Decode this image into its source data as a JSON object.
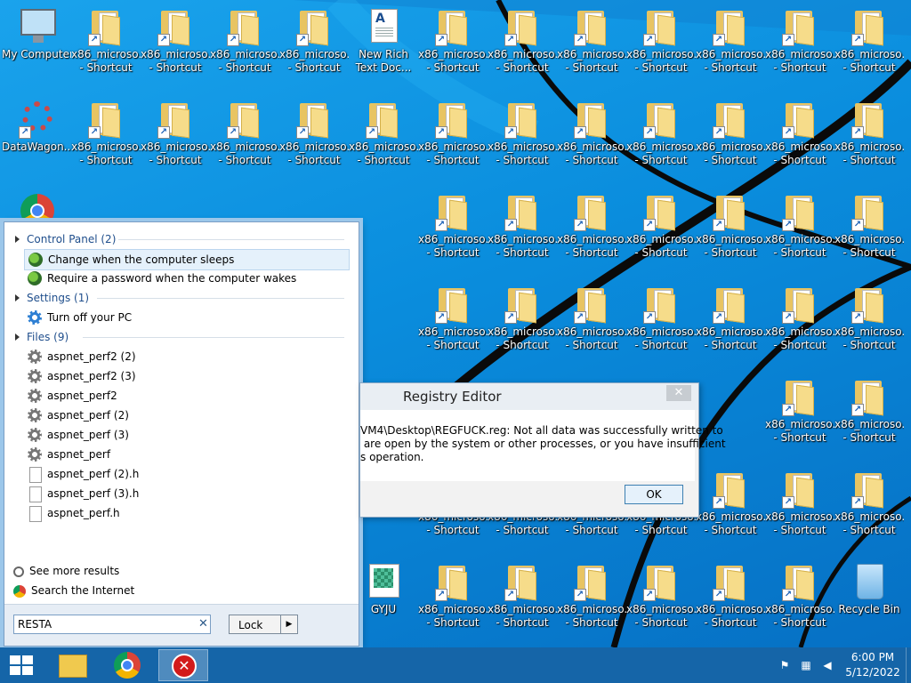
{
  "desktop": {
    "icons": {
      "my_computer": "My Computer",
      "datawagon": "DataWagon...",
      "new_rich": "New Rich\nText Doc...",
      "gyju": "GYJU",
      "recycle_bin": "Recycle Bin",
      "shortcut": "x86_microso...\n- Shortcut"
    }
  },
  "search_panel": {
    "groups": {
      "control_panel": "Control Panel (2)",
      "settings": "Settings (1)",
      "files": "Files (9)"
    },
    "control_panel_items": [
      "Change when the computer sleeps",
      "Require a password when the computer wakes"
    ],
    "settings_items": [
      "Turn off your PC"
    ],
    "file_items": [
      "aspnet_perf2 (2)",
      "aspnet_perf2 (3)",
      "aspnet_perf2",
      "aspnet_perf (2)",
      "aspnet_perf (3)",
      "aspnet_perf",
      "aspnet_perf (2).h",
      "aspnet_perf (3).h",
      "aspnet_perf.h"
    ],
    "see_more": "See more results",
    "search_internet": "Search the Internet",
    "query": "RESTA",
    "clear_glyph": "✕",
    "lock_label": "Lock"
  },
  "dialog": {
    "title": "Registry Editor",
    "close_glyph": "✕",
    "message": "VM4\\Desktop\\REGFUCK.reg: Not all data was successfully written to\n are open by the system or other processes, or you have insufficient\ns operation.",
    "ok_label": "OK"
  },
  "taskbar": {
    "time": "6:00 PM",
    "date": "5/12/2022",
    "error_glyph": "✕"
  }
}
